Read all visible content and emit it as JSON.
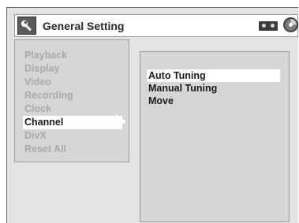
{
  "header": {
    "title": "General Setting",
    "icons": [
      "wrench-icon",
      "tape-icon",
      "disc-icon"
    ]
  },
  "menu": {
    "items": [
      {
        "label": "Playback"
      },
      {
        "label": "Display"
      },
      {
        "label": "Video"
      },
      {
        "label": "Recording"
      },
      {
        "label": "Clock"
      },
      {
        "label": "Channel",
        "selected": true
      },
      {
        "label": "DivX"
      },
      {
        "label": "Reset All"
      }
    ]
  },
  "submenu": {
    "items": [
      {
        "label": "Auto Tuning",
        "highlighted": true
      },
      {
        "label": "Manual Tuning"
      },
      {
        "label": "Move"
      }
    ]
  },
  "colors": {
    "background": "#e3e3e3",
    "panel": "#d6d6d6",
    "inactive_text": "#a9a9a9",
    "active_text": "#1a1a1a",
    "highlight": "#ffffff"
  }
}
